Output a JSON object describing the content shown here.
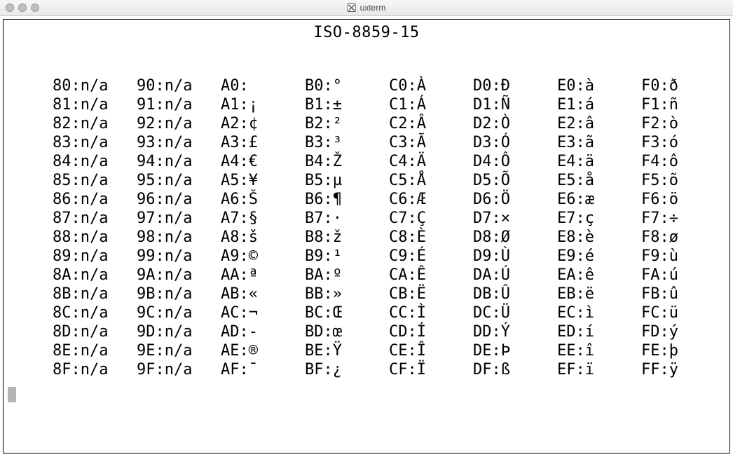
{
  "window": {
    "title": "uxterm"
  },
  "heading": "ISO-8859-15",
  "columns": [
    {
      "prefix": "8",
      "entries": [
        "80:n/a",
        "81:n/a",
        "82:n/a",
        "83:n/a",
        "84:n/a",
        "85:n/a",
        "86:n/a",
        "87:n/a",
        "88:n/a",
        "89:n/a",
        "8A:n/a",
        "8B:n/a",
        "8C:n/a",
        "8D:n/a",
        "8E:n/a",
        "8F:n/a"
      ]
    },
    {
      "prefix": "9",
      "entries": [
        "90:n/a",
        "91:n/a",
        "92:n/a",
        "93:n/a",
        "94:n/a",
        "95:n/a",
        "96:n/a",
        "97:n/a",
        "98:n/a",
        "99:n/a",
        "9A:n/a",
        "9B:n/a",
        "9C:n/a",
        "9D:n/a",
        "9E:n/a",
        "9F:n/a"
      ]
    },
    {
      "prefix": "A",
      "entries": [
        "A0: ",
        "A1:¡",
        "A2:¢",
        "A3:£",
        "A4:€",
        "A5:¥",
        "A6:Š",
        "A7:§",
        "A8:š",
        "A9:©",
        "AA:ª",
        "AB:«",
        "AC:¬",
        "AD:-",
        "AE:®",
        "AF:¯"
      ]
    },
    {
      "prefix": "B",
      "entries": [
        "B0:°",
        "B1:±",
        "B2:²",
        "B3:³",
        "B4:Ž",
        "B5:µ",
        "B6:¶",
        "B7:·",
        "B8:ž",
        "B9:¹",
        "BA:º",
        "BB:»",
        "BC:Œ",
        "BD:œ",
        "BE:Ÿ",
        "BF:¿"
      ]
    },
    {
      "prefix": "C",
      "entries": [
        "C0:À",
        "C1:Á",
        "C2:Â",
        "C3:Ã",
        "C4:Ä",
        "C5:Å",
        "C6:Æ",
        "C7:Ç",
        "C8:È",
        "C9:É",
        "CA:Ê",
        "CB:Ë",
        "CC:Ì",
        "CD:Í",
        "CE:Î",
        "CF:Ï"
      ]
    },
    {
      "prefix": "D",
      "entries": [
        "D0:Ð",
        "D1:Ñ",
        "D2:Ò",
        "D3:Ó",
        "D4:Ô",
        "D5:Õ",
        "D6:Ö",
        "D7:×",
        "D8:Ø",
        "D9:Ù",
        "DA:Ú",
        "DB:Û",
        "DC:Ü",
        "DD:Ý",
        "DE:Þ",
        "DF:ß"
      ]
    },
    {
      "prefix": "E",
      "entries": [
        "E0:à",
        "E1:á",
        "E2:â",
        "E3:ã",
        "E4:ä",
        "E5:å",
        "E6:æ",
        "E7:ç",
        "E8:è",
        "E9:é",
        "EA:ê",
        "EB:ë",
        "EC:ì",
        "ED:í",
        "EE:î",
        "EF:ï"
      ]
    },
    {
      "prefix": "F",
      "entries": [
        "F0:ð",
        "F1:ñ",
        "F2:ò",
        "F3:ó",
        "F4:ô",
        "F5:õ",
        "F6:ö",
        "F7:÷",
        "F8:ø",
        "F9:ù",
        "FA:ú",
        "FB:û",
        "FC:ü",
        "FD:ý",
        "FE:þ",
        "FF:ÿ"
      ]
    }
  ]
}
